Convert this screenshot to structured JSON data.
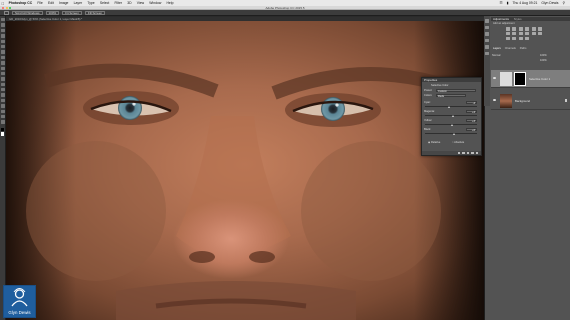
{
  "menubar": {
    "app_menu": "Photoshop CC",
    "items": [
      "File",
      "Edit",
      "Image",
      "Layer",
      "Type",
      "Select",
      "Filter",
      "3D",
      "View",
      "Window",
      "Help"
    ],
    "clock": "Thu 4 Aug 09:21",
    "user": "Glyn Dewis"
  },
  "window": {
    "title": "Adobe Photoshop CC 2015.5"
  },
  "options": {
    "buttons": [
      "Scroll All Windows",
      "100%",
      "Fit Screen",
      "Fill Screen"
    ]
  },
  "document": {
    "tab_label": "GD_2016/Glyn_@ 50% (Selective Color 1, Layer Mask/8) *"
  },
  "properties": {
    "title": "Properties",
    "adjustment": "Selective Color",
    "preset_label": "Preset:",
    "preset_value": "Custom",
    "colors_label": "Colors:",
    "colors_value": "Reds",
    "sliders": [
      {
        "label": "Cyan:",
        "value": "-4",
        "level": 0.46
      },
      {
        "label": "Magenta:",
        "value": "+4",
        "level": 0.54
      },
      {
        "label": "Yellow:",
        "value": "+3",
        "level": 0.53
      },
      {
        "label": "Black:",
        "value": "+6",
        "level": 0.56
      }
    ],
    "relative": "Relative",
    "absolute": "Absolute"
  },
  "adjustments": {
    "tabs": [
      "Adjustments",
      "Styles"
    ],
    "subtitle": "Add an adjustment"
  },
  "layers": {
    "tabs": [
      "Layers",
      "Channels",
      "Paths"
    ],
    "blend": "Normal",
    "opacity": "100%",
    "fill": "100%",
    "items": [
      {
        "name": "Selective Color 1",
        "active": true
      },
      {
        "name": "Background",
        "active": false
      }
    ]
  },
  "watermark": {
    "text": "Glyn Dewis"
  },
  "colors": {
    "accent": "#1f5e9e",
    "panel_bg": "#535353",
    "skin_mid": "#a86a4d",
    "iris": "#5c8696"
  },
  "icons": [
    "apple-icon",
    "wifi-icon",
    "battery-icon",
    "search-icon",
    "eye-icon",
    "lock-icon",
    "link-icon",
    "trash-icon"
  ]
}
